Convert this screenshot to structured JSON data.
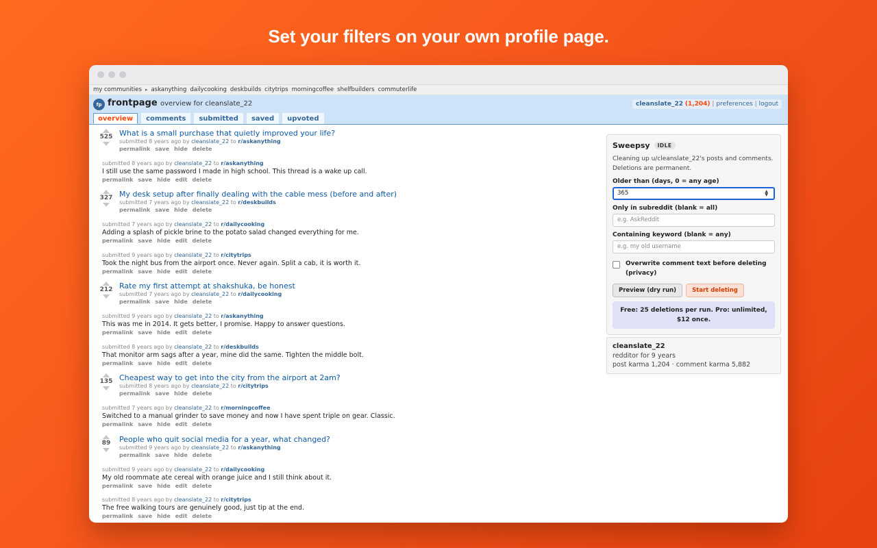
{
  "headline": "Set your filters on your own profile page.",
  "subreddit_bar": {
    "my_communities": "my communities",
    "items": [
      "askanything",
      "dailycooking",
      "deskbuilds",
      "citytrips",
      "morningcoffee",
      "shelfbuilders",
      "commuterlife"
    ]
  },
  "header": {
    "logo": "fp",
    "site_name": "frontpage",
    "page_name": "overview for cleanslate_22",
    "user": "cleanslate_22",
    "karma": "(1,204)",
    "preferences": "preferences",
    "logout": "logout",
    "separator": "|"
  },
  "tabs": [
    "overview",
    "comments",
    "submitted",
    "saved",
    "upvoted"
  ],
  "feed": [
    {
      "kind": "link",
      "score": "525",
      "title": "What is a small purchase that quietly improved your life?",
      "tagline": "submitted 8 years ago by",
      "author": "cleanslate_22",
      "to": "to",
      "subreddit": "r/askanything",
      "buttons": [
        "permalink",
        "save",
        "hide",
        "delete"
      ]
    },
    {
      "kind": "comment",
      "tagline": "submitted 8 years ago by",
      "author": "cleanslate_22",
      "to": "to",
      "subreddit": "r/askanything",
      "text": "I still use the same password I made in high school. This thread is a wake up call.",
      "buttons": [
        "permalink",
        "save",
        "hide",
        "edit",
        "delete"
      ]
    },
    {
      "kind": "link",
      "score": "327",
      "title": "My desk setup after finally dealing with the cable mess (before and after)",
      "tagline": "submitted 7 years ago by",
      "author": "cleanslate_22",
      "to": "to",
      "subreddit": "r/deskbuilds",
      "buttons": [
        "permalink",
        "save",
        "hide",
        "delete"
      ]
    },
    {
      "kind": "comment",
      "tagline": "submitted 7 years ago by",
      "author": "cleanslate_22",
      "to": "to",
      "subreddit": "r/dailycooking",
      "text": "Adding a splash of pickle brine to the potato salad changed everything for me.",
      "buttons": [
        "permalink",
        "save",
        "hide",
        "edit",
        "delete"
      ]
    },
    {
      "kind": "comment",
      "tagline": "submitted 9 years ago by",
      "author": "cleanslate_22",
      "to": "to",
      "subreddit": "r/citytrips",
      "text": "Took the night bus from the airport once. Never again. Split a cab, it is worth it.",
      "buttons": [
        "permalink",
        "save",
        "hide",
        "edit",
        "delete"
      ]
    },
    {
      "kind": "link",
      "score": "212",
      "title": "Rate my first attempt at shakshuka, be honest",
      "tagline": "submitted 7 years ago by",
      "author": "cleanslate_22",
      "to": "to",
      "subreddit": "r/dailycooking",
      "buttons": [
        "permalink",
        "save",
        "hide",
        "delete"
      ]
    },
    {
      "kind": "comment",
      "tagline": "submitted 9 years ago by",
      "author": "cleanslate_22",
      "to": "to",
      "subreddit": "r/askanything",
      "text": "This was me in 2014. It gets better, I promise. Happy to answer questions.",
      "buttons": [
        "permalink",
        "save",
        "hide",
        "edit",
        "delete"
      ]
    },
    {
      "kind": "comment",
      "tagline": "submitted 8 years ago by",
      "author": "cleanslate_22",
      "to": "to",
      "subreddit": "r/deskbuilds",
      "text": "That monitor arm sags after a year, mine did the same. Tighten the middle bolt.",
      "buttons": [
        "permalink",
        "save",
        "hide",
        "edit",
        "delete"
      ]
    },
    {
      "kind": "link",
      "score": "135",
      "title": "Cheapest way to get into the city from the airport at 2am?",
      "tagline": "submitted 8 years ago by",
      "author": "cleanslate_22",
      "to": "to",
      "subreddit": "r/citytrips",
      "buttons": [
        "permalink",
        "save",
        "hide",
        "delete"
      ]
    },
    {
      "kind": "comment",
      "tagline": "submitted 7 years ago by",
      "author": "cleanslate_22",
      "to": "to",
      "subreddit": "r/morningcoffee",
      "text": "Switched to a manual grinder to save money and now I have spent triple on gear. Classic.",
      "buttons": [
        "permalink",
        "save",
        "hide",
        "edit",
        "delete"
      ]
    },
    {
      "kind": "link",
      "score": "89",
      "title": "People who quit social media for a year, what changed?",
      "tagline": "submitted 9 years ago by",
      "author": "cleanslate_22",
      "to": "to",
      "subreddit": "r/askanything",
      "buttons": [
        "permalink",
        "save",
        "hide",
        "delete"
      ]
    },
    {
      "kind": "comment",
      "tagline": "submitted 9 years ago by",
      "author": "cleanslate_22",
      "to": "to",
      "subreddit": "r/dailycooking",
      "text": "My old roommate ate cereal with orange juice and I still think about it.",
      "buttons": [
        "permalink",
        "save",
        "hide",
        "edit",
        "delete"
      ]
    },
    {
      "kind": "comment",
      "tagline": "submitted 8 years ago by",
      "author": "cleanslate_22",
      "to": "to",
      "subreddit": "r/citytrips",
      "text": "The free walking tours are genuinely good, just tip at the end.",
      "buttons": [
        "permalink",
        "save",
        "hide",
        "edit",
        "delete"
      ]
    }
  ],
  "sweepsy": {
    "title": "Sweepsy",
    "status": "IDLE",
    "description": "Cleaning up u/cleanslate_22's posts and comments. Deletions are permanent.",
    "older_than_label": "Older than (days, 0 = any age)",
    "older_than_value": "365",
    "subreddit_label": "Only in subreddit (blank = all)",
    "subreddit_placeholder": "e.g. AskReddit",
    "keyword_label": "Containing keyword (blank = any)",
    "keyword_placeholder": "e.g. my old username",
    "overwrite_label": "Overwrite comment text before deleting (privacy)",
    "preview_button": "Preview (dry run)",
    "start_button": "Start deleting",
    "promo": "Free: 25 deletions per run. Pro: unlimited, $12 once."
  },
  "profile": {
    "name": "cleanslate_22",
    "age": "redditor for 9 years",
    "karma": "post karma 1,204 · comment karma 5,882"
  }
}
